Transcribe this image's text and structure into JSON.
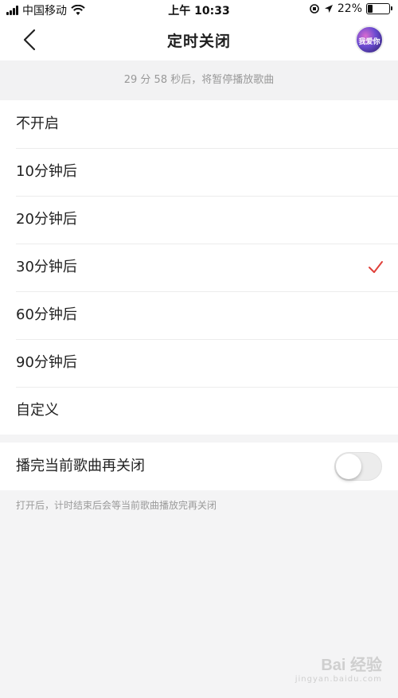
{
  "status_bar": {
    "carrier": "中国移动",
    "time": "上午 10:33",
    "battery_percent": "22%",
    "battery_level": 0.22
  },
  "nav": {
    "title": "定时关闭",
    "avatar_text": "我爱你"
  },
  "notice": "29 分 58 秒后，将暂停播放歌曲",
  "options": [
    {
      "label": "不开启",
      "selected": false
    },
    {
      "label": "10分钟后",
      "selected": false
    },
    {
      "label": "20分钟后",
      "selected": false
    },
    {
      "label": "30分钟后",
      "selected": true
    },
    {
      "label": "60分钟后",
      "selected": false
    },
    {
      "label": "90分钟后",
      "selected": false
    },
    {
      "label": "自定义",
      "selected": false
    }
  ],
  "finish_song": {
    "label": "播完当前歌曲再关闭",
    "enabled": false,
    "hint": "打开后，计时结束后会等当前歌曲播放完再关闭"
  },
  "watermark": {
    "main": "Bai 经验",
    "sub": "jingyan.baidu.com"
  },
  "colors": {
    "accent": "#e0403a",
    "background": "#f4f4f5"
  }
}
